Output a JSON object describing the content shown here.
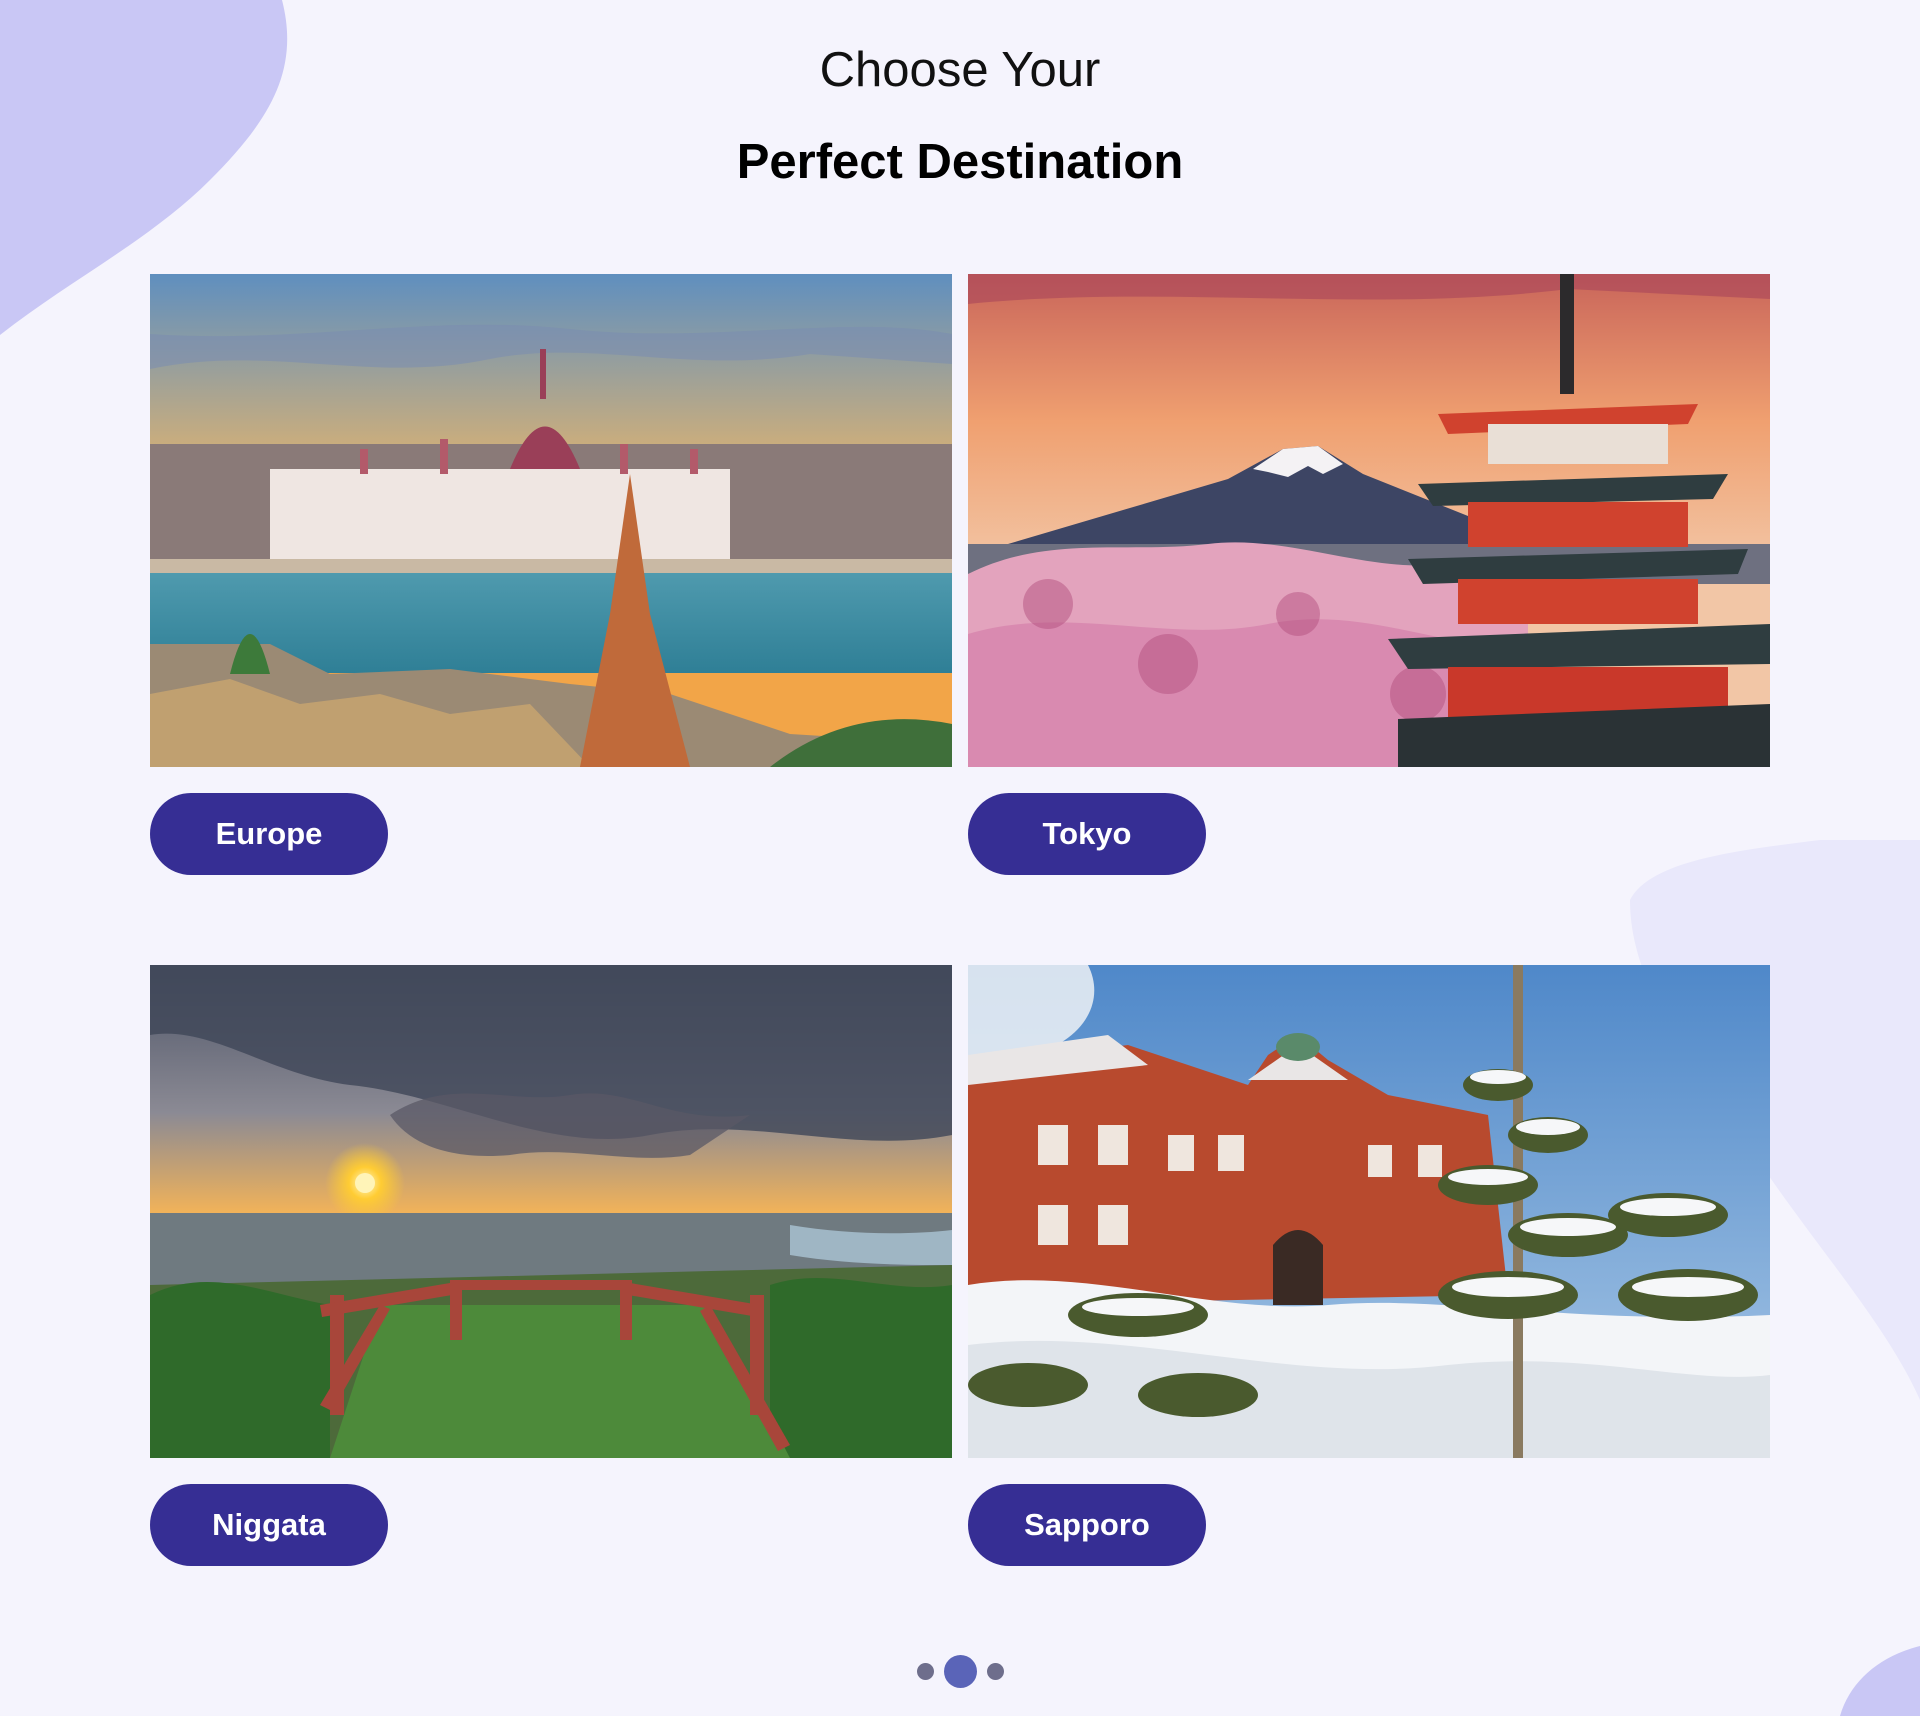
{
  "header": {
    "subtitle": "Choose Your",
    "title": "Perfect Destination"
  },
  "destinations": [
    {
      "label": "Europe",
      "photo": "budapest-parliament-at-sunset"
    },
    {
      "label": "Tokyo",
      "photo": "pagoda-cherry-blossoms-mount-fuji"
    },
    {
      "label": "Niggata",
      "photo": "sunset-viewpoint-deck"
    },
    {
      "label": "Sapporo",
      "photo": "red-brick-building-in-snow"
    }
  ],
  "carousel": {
    "pages": 3,
    "active_page": 2
  },
  "colors": {
    "background": "#f5f4fd",
    "button": "#362e94",
    "button_text": "#ffffff",
    "blob": "#c9c7f5",
    "dot": "#6e6e8c",
    "dot_active": "#5a64b8"
  }
}
